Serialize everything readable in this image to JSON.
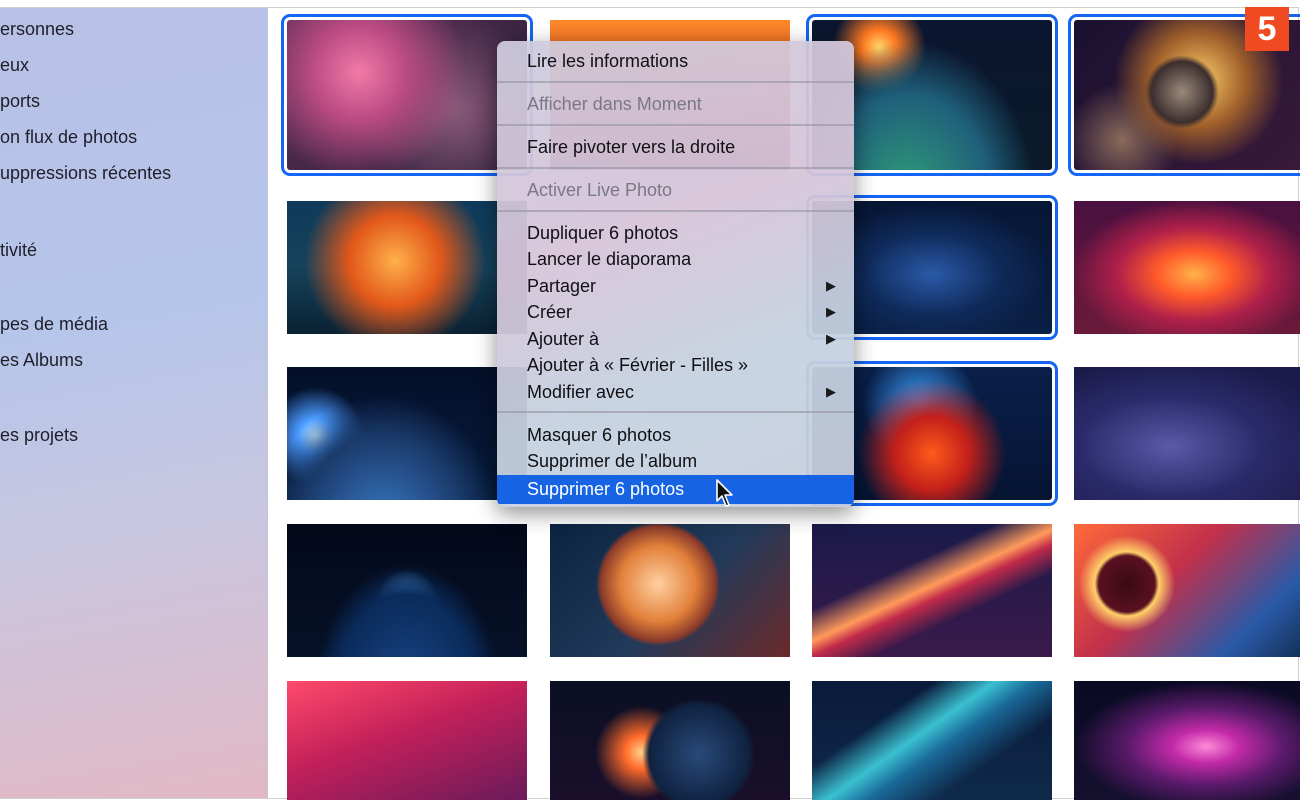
{
  "sidebar": {
    "items": [
      {
        "label": "ersonnes"
      },
      {
        "label": "eux"
      },
      {
        "label": "ports"
      },
      {
        "label": "on flux de photos"
      },
      {
        "label": "uppressions récentes"
      },
      {
        "label": "tivité"
      },
      {
        "label": "pes de média"
      },
      {
        "label": "es Albums"
      },
      {
        "label": "es projets"
      }
    ]
  },
  "step_badge": "5",
  "context_menu": {
    "items": [
      {
        "label": "Lire les informations",
        "enabled": true
      },
      {
        "label": "Afficher dans Moment",
        "enabled": false
      },
      {
        "label": "Faire pivoter vers la droite",
        "enabled": true
      },
      {
        "label": "Activer Live Photo",
        "enabled": false
      },
      {
        "label": "Dupliquer 6 photos",
        "enabled": true
      },
      {
        "label": "Lancer le diaporama",
        "enabled": true
      },
      {
        "label": "Partager",
        "enabled": true,
        "submenu": true
      },
      {
        "label": "Créer",
        "enabled": true,
        "submenu": true
      },
      {
        "label": "Ajouter à",
        "enabled": true,
        "submenu": true
      },
      {
        "label": "Ajouter à « Février - Filles »",
        "enabled": true
      },
      {
        "label": "Modifier avec",
        "enabled": true,
        "submenu": true
      },
      {
        "label": "Masquer 6 photos",
        "enabled": true
      },
      {
        "label": "Supprimer de l’album",
        "enabled": true
      },
      {
        "label": "Supprimer 6 photos",
        "enabled": true,
        "highlighted": true
      }
    ],
    "submenu_glyph": "▶"
  },
  "photos": [
    {
      "theme": "pink-nebula",
      "selected": true
    },
    {
      "theme": "red-orange-sky",
      "selected": false
    },
    {
      "theme": "earth-sunrise",
      "selected": true
    },
    {
      "theme": "golden-planet",
      "selected": true
    },
    {
      "theme": "orange-nebula",
      "selected": false
    },
    {
      "theme": "hidden",
      "selected": false
    },
    {
      "theme": "blue-starfield",
      "selected": true
    },
    {
      "theme": "red-swirl",
      "selected": false
    },
    {
      "theme": "earth-night-lights",
      "selected": false
    },
    {
      "theme": "hidden",
      "selected": false
    },
    {
      "theme": "red-blue-nebula",
      "selected": true
    },
    {
      "theme": "purple-haze",
      "selected": false
    },
    {
      "theme": "earth-blue-glow",
      "selected": false
    },
    {
      "theme": "striped-planet",
      "selected": false
    },
    {
      "theme": "red-galaxy-streak",
      "selected": false
    },
    {
      "theme": "dark-planet-eclipse",
      "selected": false
    },
    {
      "theme": "pink-red-clouds",
      "selected": false
    },
    {
      "theme": "astronaut-earth",
      "selected": false
    },
    {
      "theme": "teal-nebula",
      "selected": false
    },
    {
      "theme": "magenta-spiral",
      "selected": false
    }
  ],
  "colors": {
    "selection": "#1565f5",
    "menu_highlight": "#1664e4",
    "badge": "#ef4a22"
  },
  "icons": [
    "submenu-arrow-icon",
    "mouse-pointer-icon"
  ]
}
